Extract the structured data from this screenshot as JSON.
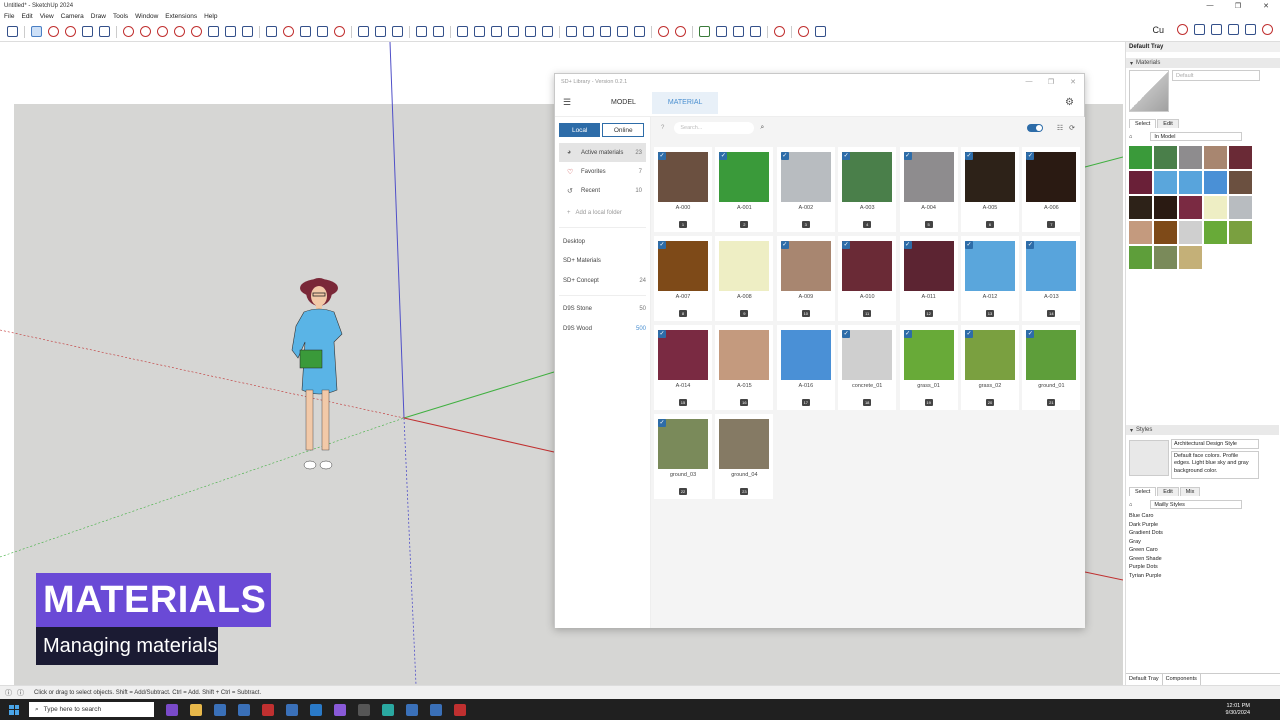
{
  "window": {
    "title": "Untitled* - SketchUp 2024",
    "controls": [
      "—",
      "❐",
      "✕"
    ]
  },
  "menu": [
    "File",
    "Edit",
    "View",
    "Camera",
    "Draw",
    "Tools",
    "Window",
    "Extensions",
    "Help"
  ],
  "toolbar_right_label": "Cu",
  "overlay": {
    "title": "MATERIALS",
    "subtitle": "Managing materials"
  },
  "library": {
    "title": "SD+ Library - Version 0.2.1",
    "tabs": [
      "MODEL",
      "MATERIAL"
    ],
    "active_tab": "MATERIAL",
    "source_buttons": {
      "local": "Local",
      "online": "Online"
    },
    "search_placeholder": "Search...",
    "help_mark": "?",
    "nav": [
      {
        "label": "Active materials",
        "count": "23",
        "icon": "palette-icon"
      },
      {
        "label": "Favorites",
        "count": "7",
        "icon": "heart-icon"
      },
      {
        "label": "Recent",
        "count": "10",
        "icon": "history-icon"
      }
    ],
    "add_folder": "Add a local folder",
    "folders": [
      {
        "label": "Desktop",
        "count": ""
      },
      {
        "label": "SD+ Materials",
        "count": ""
      },
      {
        "label": "SD+ Concept",
        "count": "24"
      },
      {
        "label": "D9S Stone",
        "count": "50"
      },
      {
        "label": "D9S Wood",
        "count": "500"
      }
    ],
    "materials": [
      {
        "name": "A-000",
        "num": "1",
        "color": "#6b5040",
        "checked": true
      },
      {
        "name": "A-001",
        "num": "2",
        "color": "#3a9a3a",
        "checked": true
      },
      {
        "name": "A-002",
        "num": "3",
        "color": "#b8bcc0",
        "checked": true
      },
      {
        "name": "A-003",
        "num": "4",
        "color": "#4a7f4a",
        "checked": true
      },
      {
        "name": "A-004",
        "num": "5",
        "color": "#8e8c8e",
        "checked": true
      },
      {
        "name": "A-005",
        "num": "6",
        "color": "#2d2218",
        "checked": true
      },
      {
        "name": "A-006",
        "num": "7",
        "color": "#2a1a12",
        "checked": true
      },
      {
        "name": "A-007",
        "num": "8",
        "color": "#7e4a18",
        "checked": true
      },
      {
        "name": "A-008",
        "num": "9",
        "color": "#eeeec4",
        "checked": false
      },
      {
        "name": "A-009",
        "num": "10",
        "color": "#a88670",
        "checked": true
      },
      {
        "name": "A-010",
        "num": "11",
        "color": "#6a2a36",
        "checked": true
      },
      {
        "name": "A-011",
        "num": "12",
        "color": "#5c2432",
        "checked": true
      },
      {
        "name": "A-012",
        "num": "13",
        "color": "#5aa6dc",
        "checked": true
      },
      {
        "name": "A-013",
        "num": "14",
        "color": "#58a4dc",
        "checked": true
      },
      {
        "name": "A-014",
        "num": "15",
        "color": "#7a2a42",
        "checked": true
      },
      {
        "name": "A-015",
        "num": "16",
        "color": "#c49a7e",
        "checked": false
      },
      {
        "name": "A-016",
        "num": "17",
        "color": "#4a90d6",
        "checked": false
      },
      {
        "name": "concrete_01",
        "num": "18",
        "color": "#cfcfcf",
        "checked": true
      },
      {
        "name": "grass_01",
        "num": "19",
        "color": "#68aa38",
        "checked": true
      },
      {
        "name": "grass_02",
        "num": "20",
        "color": "#7aa040",
        "checked": true
      },
      {
        "name": "ground_01",
        "num": "21",
        "color": "#5e9e3a",
        "checked": true
      },
      {
        "name": "ground_03",
        "num": "22",
        "color": "#7a8a5a",
        "checked": true
      },
      {
        "name": "ground_04",
        "num": "23",
        "color": "#857a64",
        "checked": false
      }
    ]
  },
  "tray": {
    "header": "Default Tray",
    "materials_panel": "Materials",
    "material_name_placeholder": "Default",
    "tabs": [
      "Select",
      "Edit"
    ],
    "collection": "In Model",
    "swatches": [
      "#3a9a3a",
      "#4a7f4a",
      "#8e8c8e",
      "#a88670",
      "#6a2a36",
      "#6a2038",
      "#5aa6dc",
      "#58a4dc",
      "#4a90d6",
      "#6b5040",
      "#2d2218",
      "#2a1a12",
      "#7a2a42",
      "#eeeec4",
      "#b8bcc0",
      "#c49a7e",
      "#7e4a18",
      "#cfcfcf",
      "#68aa38",
      "#7aa040",
      "#5e9e3a",
      "#7a8a5a",
      "#c4b078"
    ],
    "styles_panel": "Styles",
    "style_name": "Architectural Design Style",
    "style_desc": "Default face colors. Profile edges. Light blue sky and gray background color.",
    "style_tabs": [
      "Select",
      "Edit",
      "Mix"
    ],
    "style_collection": "Mailly Styles",
    "style_list": [
      "Blue Caro",
      "Dark Purple",
      "Gradient Dots",
      "Gray",
      "Green Caro",
      "Green Shade",
      "Purple Dots",
      "Tyrian Purple"
    ],
    "bottom_tabs": [
      "Default Tray",
      "Components"
    ]
  },
  "status": {
    "message": "Click or drag to select objects. Shift = Add/Subtract. Ctrl = Add. Shift + Ctrl = Subtract."
  },
  "taskbar": {
    "search": "Type here to search",
    "time": "12:01 PM",
    "date": "9/30/2024"
  }
}
